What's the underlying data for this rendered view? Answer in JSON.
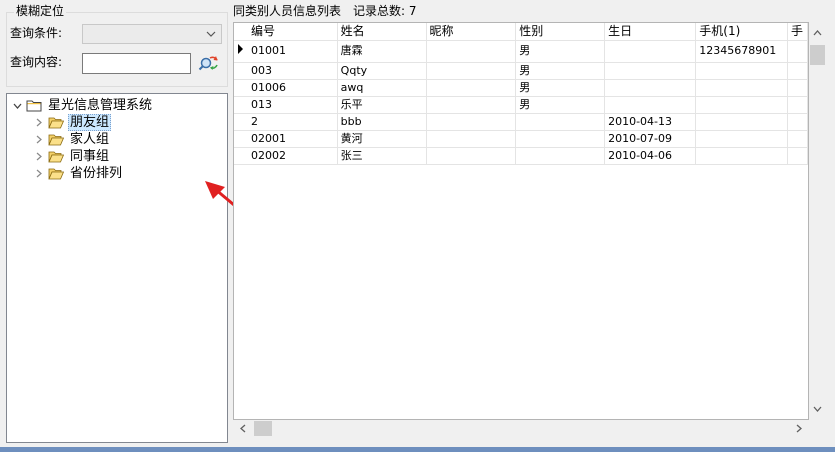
{
  "search_group": {
    "legend": "模糊定位",
    "condition_label": "查询条件:",
    "condition_value": "",
    "content_label": "查询内容:",
    "content_value": "",
    "search_button_icon": "search-icon"
  },
  "tree": {
    "root": {
      "label": "星光信息管理系统",
      "expanded": true,
      "icon": "folder-icon"
    },
    "children": [
      {
        "label": "朋友组",
        "selected": true,
        "icon": "open-folder-icon"
      },
      {
        "label": "家人组",
        "selected": false,
        "icon": "open-folder-icon"
      },
      {
        "label": "同事组",
        "selected": false,
        "icon": "open-folder-icon"
      },
      {
        "label": "省份排列",
        "selected": false,
        "icon": "open-folder-icon"
      }
    ]
  },
  "list": {
    "title": "同类别人员信息列表",
    "count_text": "记录总数: 7",
    "columns": [
      "编号",
      "姓名",
      "昵称",
      "性别",
      "生日",
      "手机(1)",
      "手"
    ],
    "rows": [
      [
        "01001",
        "唐霖",
        "",
        "男",
        "",
        "12345678901",
        ""
      ],
      [
        "003",
        "Qqty",
        "",
        "男",
        "",
        "",
        ""
      ],
      [
        "01006",
        "awq",
        "",
        "男",
        "",
        "",
        ""
      ],
      [
        "013",
        "乐平",
        "",
        "男",
        "",
        "",
        ""
      ],
      [
        "2",
        "bbb",
        "",
        "",
        "2010-04-13",
        "",
        ""
      ],
      [
        "02001",
        "黄河",
        "",
        "",
        "2010-07-09",
        "",
        ""
      ],
      [
        "02002",
        "张三",
        "",
        "",
        "2010-04-06",
        "",
        ""
      ]
    ],
    "current_row": 0
  },
  "colors": {
    "window_bg": "#f0f0f0",
    "selection_bg": "#cce8ff",
    "arrow_annotation": "#e02020",
    "bottom_border": "#6e8fbe"
  }
}
